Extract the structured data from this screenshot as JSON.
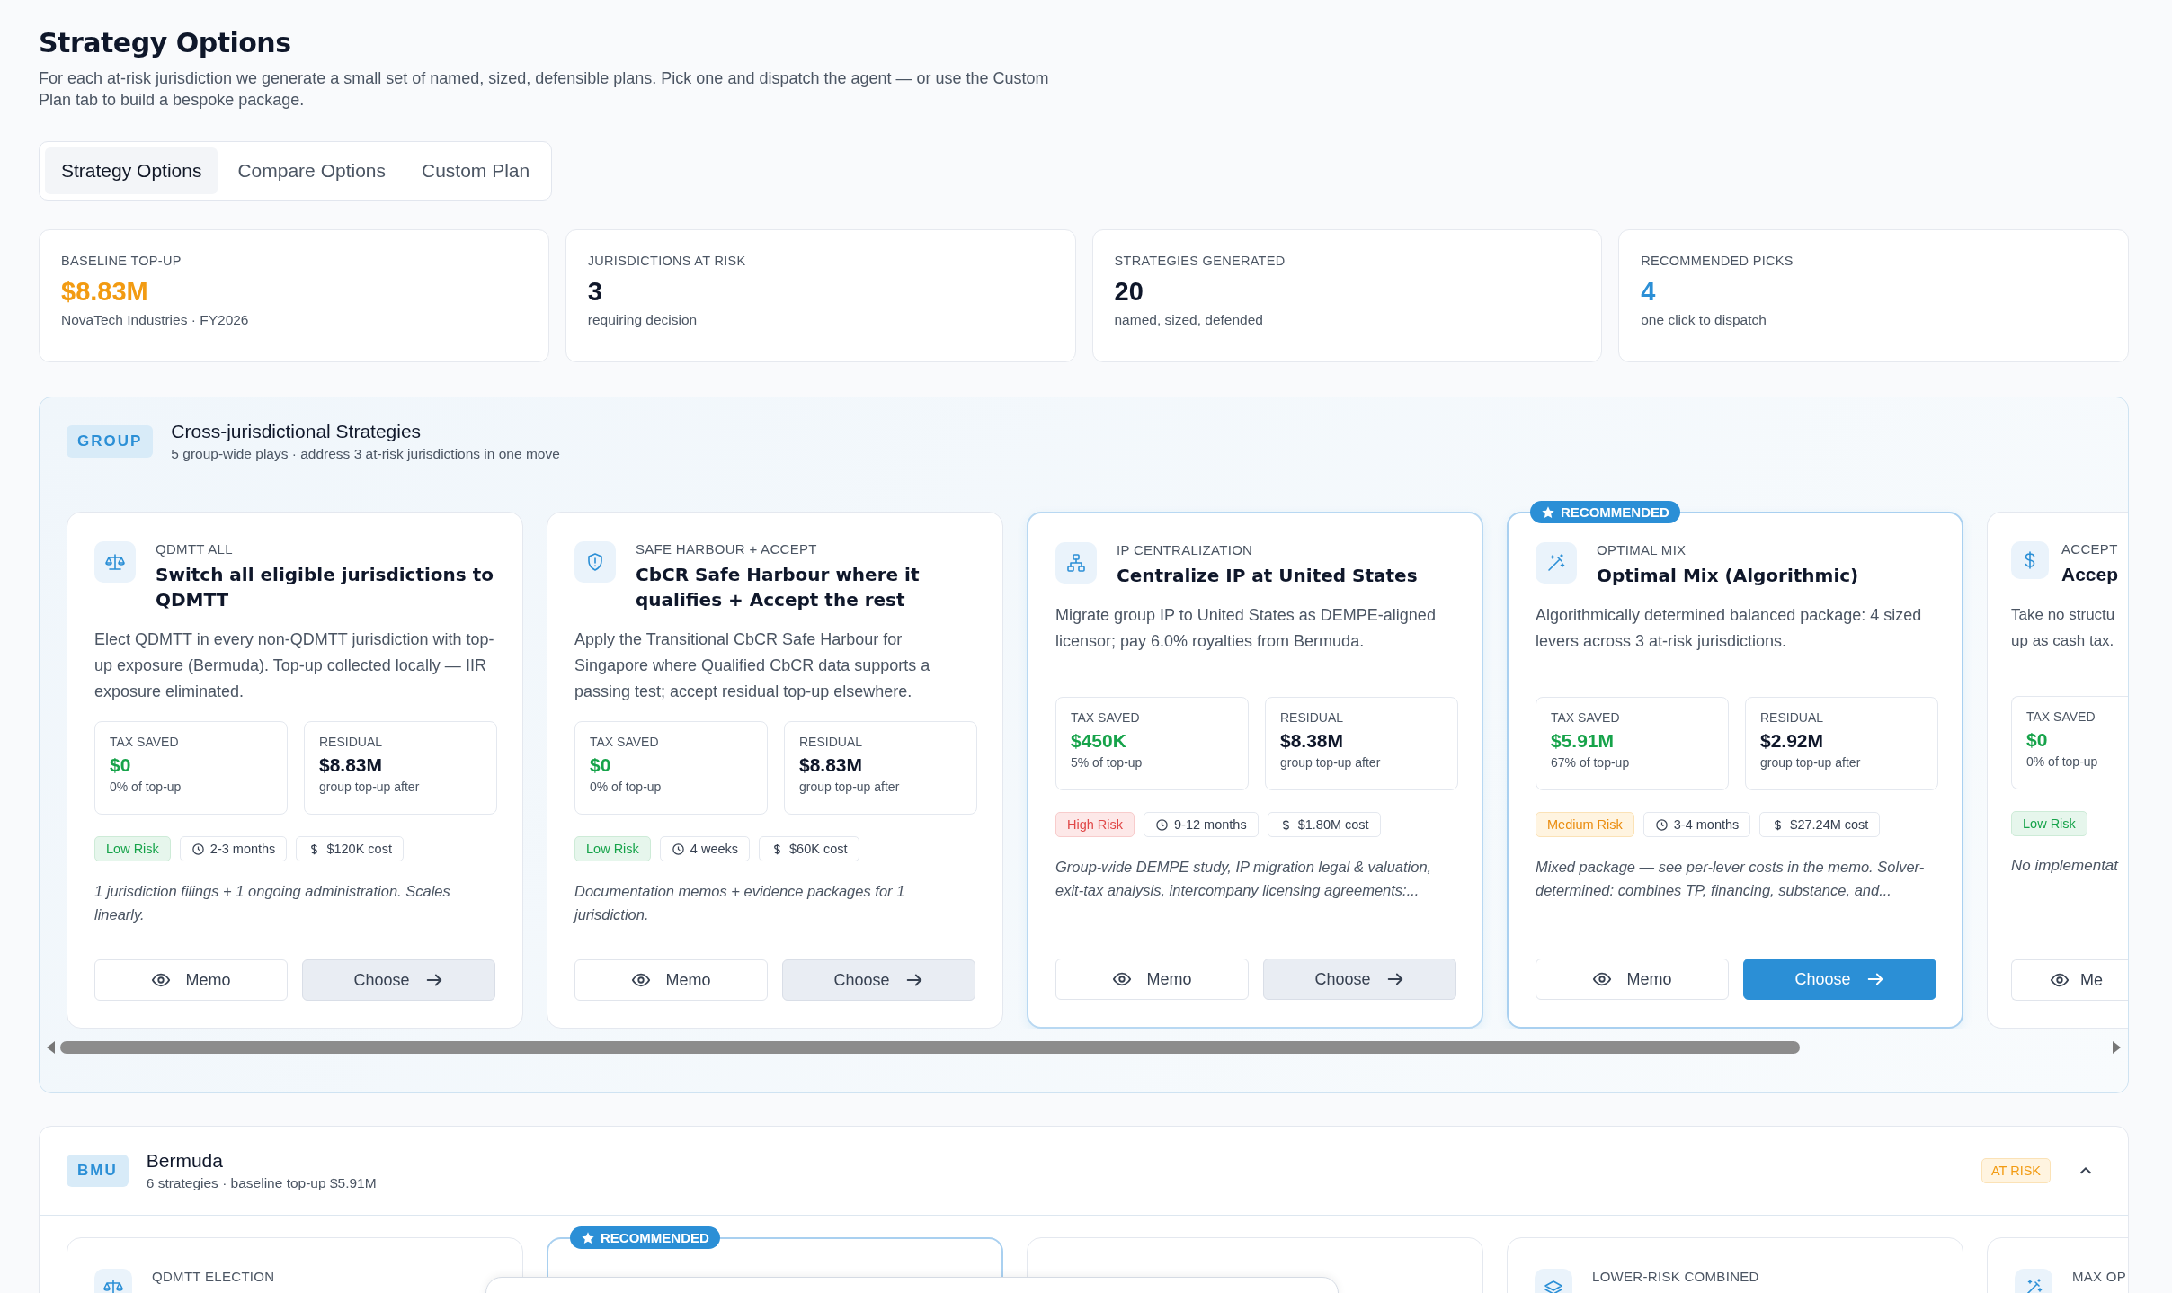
{
  "page": {
    "title": "Strategy Options",
    "description": "For each at-risk jurisdiction we generate a small set of named, sized, defensible plans. Pick one and dispatch the agent — or use the Custom Plan tab to build a bespoke package."
  },
  "tabs": [
    {
      "label": "Strategy Options",
      "selected": true
    },
    {
      "label": "Compare Options",
      "selected": false
    },
    {
      "label": "Custom Plan",
      "selected": false
    }
  ],
  "stats": [
    {
      "label": "BASELINE TOP-UP",
      "value": "$8.83M",
      "note": "NovaTech Industries · FY2026",
      "kind": "warning"
    },
    {
      "label": "JURISDICTIONS AT RISK",
      "value": "3",
      "note": "requiring decision",
      "kind": "plain"
    },
    {
      "label": "STRATEGIES GENERATED",
      "value": "20",
      "note": "named, sized, defended",
      "kind": "plain"
    },
    {
      "label": "RECOMMENDED PICKS",
      "value": "4",
      "note": "one click to dispatch",
      "kind": "accent"
    }
  ],
  "group_section": {
    "badge": "GROUP",
    "title": "Cross-jurisdictional Strategies",
    "subtitle": "5 group-wide plays · address 3 at-risk jurisdictions in one move",
    "strategies": [
      {
        "kind": "qdmtt",
        "kicker": "QDMTT ALL",
        "title": "Switch all eligible jurisdictions to QDMTT",
        "description": "Elect QDMTT in every non-QDMTT jurisdiction with top-up exposure (Bermuda). Top-up collected locally — IIR exposure eliminated.",
        "recommended": false,
        "highlighted": false,
        "metrics": [
          {
            "kind": "saved",
            "label": "TAX SAVED",
            "value": "$0",
            "note": "0% of top-up"
          },
          {
            "kind": "residual",
            "label": "RESIDUAL",
            "value": "$8.83M",
            "note": "group top-up after"
          }
        ],
        "tags": [
          {
            "kind": "risk-low",
            "label": "Low Risk"
          },
          {
            "kind": "duration",
            "label": "2-3 months"
          },
          {
            "kind": "cost",
            "label": "$120K cost"
          }
        ],
        "footnote": "1 jurisdiction filings + 1 ongoing administration. Scales linearly.",
        "buttons": [
          {
            "kind": "memo",
            "label": "Memo"
          },
          {
            "kind": "choose",
            "label": "Choose",
            "primary": false
          }
        ]
      },
      {
        "kind": "safe-harbour",
        "kicker": "SAFE HARBOUR + ACCEPT",
        "title": "CbCR Safe Harbour where it qualifies + Accept the rest",
        "description": "Apply the Transitional CbCR Safe Harbour for Singapore where Qualified CbCR data supports a passing test; accept residual top-up elsewhere.",
        "recommended": false,
        "highlighted": false,
        "metrics": [
          {
            "kind": "saved",
            "label": "TAX SAVED",
            "value": "$0",
            "note": "0% of top-up"
          },
          {
            "kind": "residual",
            "label": "RESIDUAL",
            "value": "$8.83M",
            "note": "group top-up after"
          }
        ],
        "tags": [
          {
            "kind": "risk-low",
            "label": "Low Risk"
          },
          {
            "kind": "duration",
            "label": "4 weeks"
          },
          {
            "kind": "cost",
            "label": "$60K cost"
          }
        ],
        "footnote": "Documentation memos + evidence packages for 1 jurisdiction.",
        "buttons": [
          {
            "kind": "memo",
            "label": "Memo"
          },
          {
            "kind": "choose",
            "label": "Choose",
            "primary": false
          }
        ]
      },
      {
        "kind": "ip",
        "kicker": "IP CENTRALIZATION",
        "title": "Centralize IP at United States",
        "description": "Migrate group IP to United States as DEMPE-aligned licensor; pay 6.0% royalties from Bermuda.",
        "recommended": false,
        "highlighted": true,
        "metrics": [
          {
            "kind": "saved",
            "label": "TAX SAVED",
            "value": "$450K",
            "note": "5% of top-up"
          },
          {
            "kind": "residual",
            "label": "RESIDUAL",
            "value": "$8.38M",
            "note": "group top-up after"
          }
        ],
        "tags": [
          {
            "kind": "risk-high",
            "label": "High Risk"
          },
          {
            "kind": "duration",
            "label": "9-12 months"
          },
          {
            "kind": "cost",
            "label": "$1.80M cost"
          }
        ],
        "footnote": "Group-wide DEMPE study, IP migration legal & valuation, exit-tax analysis, intercompany licensing agreements:...",
        "buttons": [
          {
            "kind": "memo",
            "label": "Memo"
          },
          {
            "kind": "choose",
            "label": "Choose",
            "primary": false
          }
        ]
      },
      {
        "kind": "optimal",
        "kicker": "OPTIMAL MIX",
        "title": "Optimal Mix (Algorithmic)",
        "description": "Algorithmically determined balanced package: 4 sized levers across 3 at-risk jurisdictions.",
        "recommended": true,
        "badge": "RECOMMENDED",
        "highlighted": true,
        "metrics": [
          {
            "kind": "saved",
            "label": "TAX SAVED",
            "value": "$5.91M",
            "note": "67% of top-up"
          },
          {
            "kind": "residual",
            "label": "RESIDUAL",
            "value": "$2.92M",
            "note": "group top-up after"
          }
        ],
        "tags": [
          {
            "kind": "risk-medium",
            "label": "Medium Risk"
          },
          {
            "kind": "duration",
            "label": "3-4 months"
          },
          {
            "kind": "cost",
            "label": "$27.24M cost"
          }
        ],
        "footnote": "Mixed package — see per-lever costs in the memo. Solver-determined: combines TP, financing, substance, and...",
        "buttons": [
          {
            "kind": "memo",
            "label": "Memo"
          },
          {
            "kind": "choose",
            "label": "Choose",
            "primary": true
          }
        ]
      },
      {
        "kind": "accept",
        "kicker": "ACCEPT",
        "title": "Accep",
        "description": "Take no structu\nup as cash tax.",
        "recommended": false,
        "highlighted": false,
        "partial": true,
        "metrics": [
          {
            "kind": "saved",
            "label": "TAX SAVED",
            "value": "$0",
            "note": "0% of top-up"
          }
        ],
        "tags": [
          {
            "kind": "risk-low",
            "label": "Low Risk"
          }
        ],
        "footnote": "No implementat",
        "buttons": [
          {
            "kind": "memo",
            "label": "Me"
          }
        ]
      }
    ]
  },
  "jurisdiction_section": {
    "badge": "BMU",
    "title": "Bermuda",
    "subtitle": "6 strategies · baseline top-up $5.91M",
    "status": "AT RISK",
    "expanded": true,
    "strategies": [
      {
        "kind": "qdmtt",
        "kicker": "QDMTT ELECTION",
        "recommended": false
      },
      {
        "kind": "hidden",
        "recommended": true,
        "badge": "RECOMMENDED"
      },
      {
        "kind": "hidden",
        "recommended": false
      },
      {
        "kind": "combined",
        "kicker": "LOWER-RISK COMBINED",
        "recommended": false
      },
      {
        "kind": "optimal",
        "kicker": "MAX OP",
        "recommended": false
      }
    ]
  }
}
